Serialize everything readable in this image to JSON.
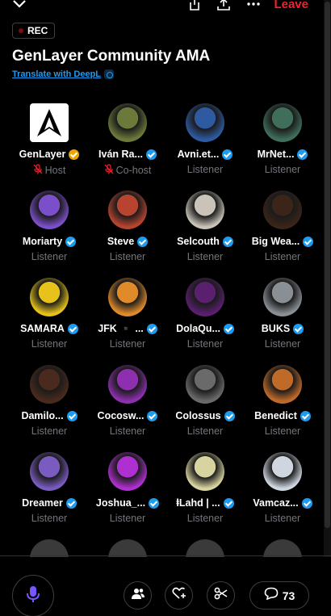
{
  "header": {
    "leave_label": "Leave",
    "icons": [
      "chevron-down-icon",
      "minimize-icon",
      "share-icon",
      "more-icon"
    ]
  },
  "space": {
    "rec_label": "REC",
    "title": "GenLayer Community AMA",
    "translate_label": "Translate with DeepL"
  },
  "participants": [
    {
      "name": "GenLayer",
      "role": "Host",
      "muted": true,
      "badge": "gold",
      "avatar": "logo"
    },
    {
      "name": "Iván Ra...",
      "role": "Co-host",
      "muted": true,
      "badge": "blue",
      "avatar": "#6b7a3a"
    },
    {
      "name": "Avni.et...",
      "role": "Listener",
      "muted": false,
      "badge": "blue",
      "avatar": "#2d5aa0"
    },
    {
      "name": "MrNet...",
      "role": "Listener",
      "muted": false,
      "badge": "blue",
      "avatar": "#3f6e5a"
    },
    {
      "name": "Moriarty",
      "role": "Listener",
      "muted": false,
      "badge": "blue",
      "avatar": "#7b4fc9"
    },
    {
      "name": "Steve",
      "role": "Listener",
      "muted": false,
      "badge": "blue",
      "avatar": "#b8442f"
    },
    {
      "name": "Selcouth",
      "role": "Listener",
      "muted": false,
      "badge": "blue",
      "avatar": "#c9c3b8"
    },
    {
      "name": "Big Wea...",
      "role": "Listener",
      "muted": false,
      "badge": "blue",
      "avatar": "#3b2418"
    },
    {
      "name": "SAMARA",
      "role": "Listener",
      "muted": false,
      "badge": "blue",
      "avatar": "#e6c21a"
    },
    {
      "name": "JFK ▪️ ...",
      "role": "Listener",
      "muted": false,
      "badge": "blue",
      "avatar": "#e08a2a"
    },
    {
      "name": "DolaQu...",
      "role": "Listener",
      "muted": false,
      "badge": "blue",
      "avatar": "#5a1f6e"
    },
    {
      "name": "BUKS",
      "role": "Listener",
      "muted": false,
      "badge": "blue",
      "avatar": "#8a8f96"
    },
    {
      "name": "Damilo...",
      "role": "Listener",
      "muted": false,
      "badge": "blue",
      "avatar": "#4a2a1c"
    },
    {
      "name": "Cocosw...",
      "role": "Listener",
      "muted": false,
      "badge": "blue",
      "avatar": "#8e2fb0"
    },
    {
      "name": "Colossus",
      "role": "Listener",
      "muted": false,
      "badge": "blue",
      "avatar": "#6a6a6a"
    },
    {
      "name": "Benedict",
      "role": "Listener",
      "muted": false,
      "badge": "blue",
      "avatar": "#c06a2a"
    },
    {
      "name": "Dreamer",
      "role": "Listener",
      "muted": false,
      "badge": "blue",
      "avatar": "#7a5bc0"
    },
    {
      "name": "Joshua_...",
      "role": "Listener",
      "muted": false,
      "badge": "blue",
      "avatar": "#b02fd0"
    },
    {
      "name": "ⱡLahd | ...",
      "role": "Listener",
      "muted": false,
      "badge": "blue",
      "avatar": "#d8d4a0"
    },
    {
      "name": "Vamcaz...",
      "role": "Listener",
      "muted": false,
      "badge": "blue",
      "avatar": "#cfd6e0"
    }
  ],
  "controls": {
    "reactions_count": "73",
    "icons": [
      "microphone-icon",
      "people-icon",
      "add-heart-icon",
      "clip-icon",
      "comment-icon"
    ]
  },
  "colors": {
    "accent": "#1d9bf0",
    "leave": "#f4212e",
    "muted_text": "#71767b",
    "host_badge": "#e8a400"
  }
}
